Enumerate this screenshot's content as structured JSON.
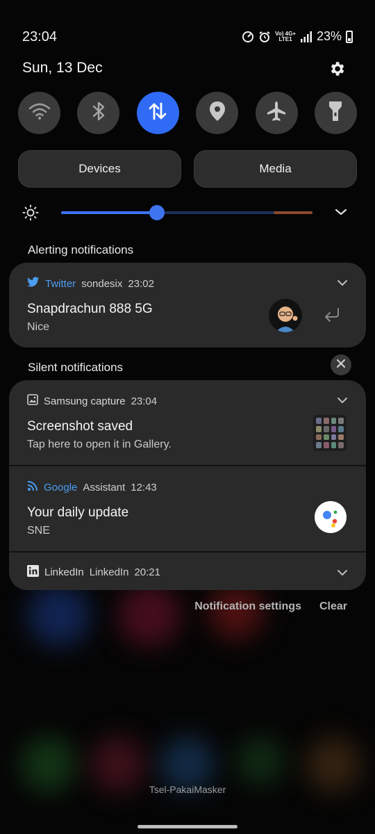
{
  "status": {
    "time": "23:04",
    "battery": "23%",
    "net_top": "Vo) 4G+",
    "net_bottom": "LTE1"
  },
  "header": {
    "date": "Sun, 13 Dec"
  },
  "quick_settings": [
    {
      "name": "wifi",
      "icon": "wifi-icon",
      "active": false
    },
    {
      "name": "bluetooth",
      "icon": "bluetooth-icon",
      "active": false
    },
    {
      "name": "mobile-data",
      "icon": "data-arrows-icon",
      "active": true
    },
    {
      "name": "location",
      "icon": "location-pin-icon",
      "active": false
    },
    {
      "name": "airplane",
      "icon": "airplane-icon",
      "active": false
    },
    {
      "name": "flashlight",
      "icon": "flashlight-icon",
      "active": false
    }
  ],
  "pills": {
    "devices": "Devices",
    "media": "Media"
  },
  "brightness": {
    "level": 0.38
  },
  "sections": {
    "alerting": "Alerting notifications",
    "silent": "Silent notifications"
  },
  "notifications": {
    "twitter": {
      "app": "Twitter",
      "account": "sondesix",
      "time": "23:02",
      "title": "Snapdrachun 888 5G",
      "text": "Nice"
    },
    "samsung": {
      "app": "Samsung capture",
      "time": "23:04",
      "title": "Screenshot saved",
      "text": "Tap here to open it in Gallery."
    },
    "google": {
      "app": "Google",
      "sub": "Assistant",
      "time": "12:43",
      "title": "Your daily update",
      "text": "SNE"
    },
    "linkedin": {
      "app": "LinkedIn",
      "sub": "LinkedIn",
      "time": "20:21"
    }
  },
  "footer": {
    "settings": "Notification settings",
    "clear": "Clear",
    "carrier": "Tsel-PakaiMasker"
  },
  "colors": {
    "accent": "#2f6bf5",
    "twitter_blue": "#4a9df0"
  }
}
